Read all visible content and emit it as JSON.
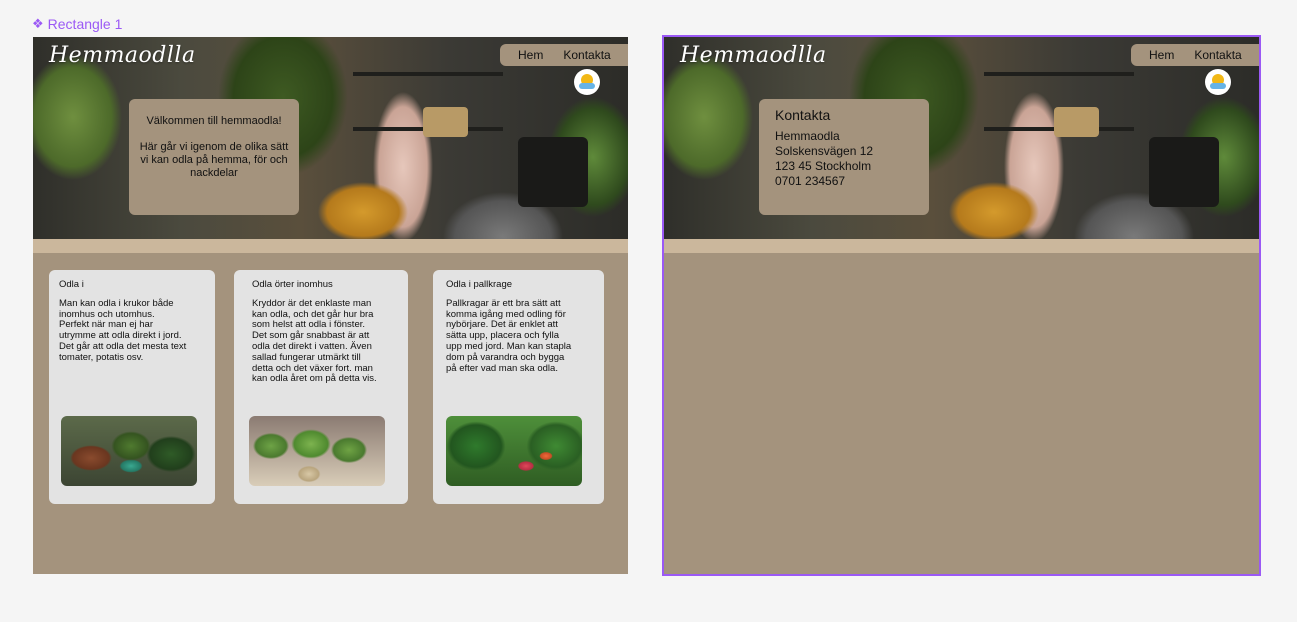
{
  "component": {
    "label": "Rectangle 1"
  },
  "home": {
    "brand": "Hemmaodlla",
    "nav": [
      "Hem",
      "Kontakta"
    ],
    "welcome_title": "Välkommen till hemmaodla!",
    "welcome_body": "Här går vi igenom de olika sätt vi kan odla på hemma, för och nackdelar",
    "cards": [
      {
        "title": "Odla i",
        "body": "Man kan odla i krukor både inomhus och utomhus. Perfekt när man ej har utrymme att odla direkt i jord. Det går att odla det mesta text tomater, potatis osv."
      },
      {
        "title": "Odla örter inomhus",
        "body": "Kryddor är det enklaste man kan odla, och det går hur bra som helst att odla i fönster. Det som går snabbast är att odla det direkt i vatten. Även sallad fungerar utmärkt till detta och det växer fort. man kan odla året om på detta vis."
      },
      {
        "title": "Odla i pallkrage",
        "body": "Pallkragar är ett bra sätt att komma igång med odling för nybörjare. Det är enklet att sätta upp, placera och fylla upp med jord. Man kan stapla dom på varandra och bygga på efter vad man ska odla."
      }
    ]
  },
  "contact": {
    "brand": "Hemmaodlla",
    "nav": [
      "Hem",
      "Kontakta"
    ],
    "title": "Kontakta",
    "lines": [
      "Hemmaodla",
      "Solskensvägen 12",
      "123 45 Stockholm",
      "0701 234567"
    ]
  },
  "colors": {
    "frame_bg": "#a4937d",
    "selection": "#9b59f5",
    "card_bg": "#e3e3e3"
  }
}
